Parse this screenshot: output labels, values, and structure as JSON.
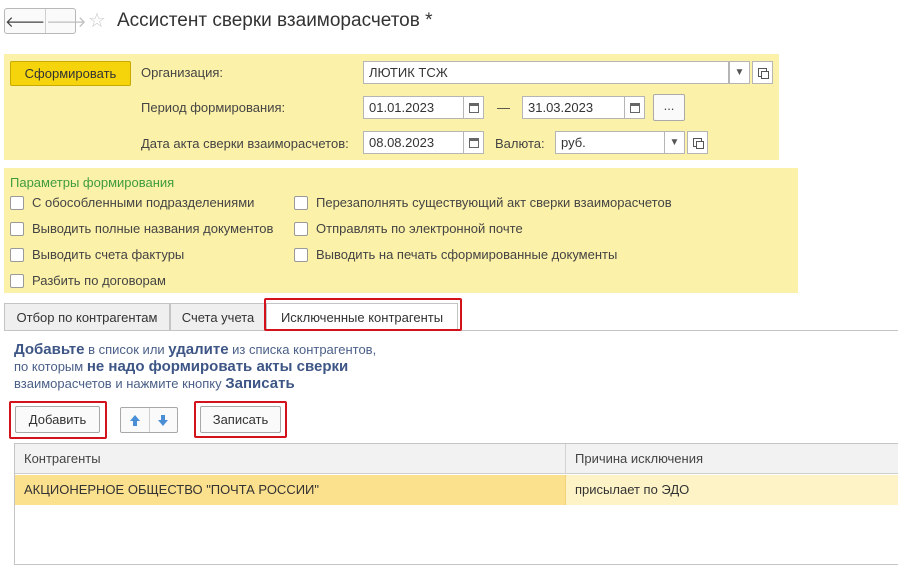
{
  "window": {
    "title": "Ассистент сверки взаиморасчетов *"
  },
  "toolbar": {
    "generate_label": "Сформировать"
  },
  "form": {
    "organization_label": "Организация:",
    "organization_value": "ЛЮТИК ТСЖ",
    "period_label": "Период формирования:",
    "period_from": "01.01.2023",
    "period_dash": "—",
    "period_to": "31.03.2023",
    "period_more": "...",
    "act_date_label": "Дата акта сверки взаиморасчетов:",
    "act_date_value": "08.08.2023",
    "currency_label": "Валюта:",
    "currency_value": "руб."
  },
  "params": {
    "title": "Параметры формирования",
    "left": [
      "С обособленными подразделениями",
      "Выводить полные названия документов",
      "Выводить счета фактуры",
      "Разбить по договорам"
    ],
    "right": [
      "Перезаполнять существующий акт сверки взаиморасчетов",
      "Отправлять по электронной почте",
      "Выводить на печать сформированные документы"
    ]
  },
  "tabs": [
    "Отбор по контрагентам",
    "Счета учета",
    "Исключенные контрагенты"
  ],
  "hint": {
    "p1": "Добавьте",
    "p2": " в список или ",
    "p3": "удалите",
    "p4": " из списка контрагентов,",
    "p5": "по которым ",
    "p6": "не надо формировать акты сверки",
    "p7": "взаиморасчетов и нажмите кнопку ",
    "p8": "Записать"
  },
  "actions": {
    "add_label": "Добавить",
    "save_label": "Записать"
  },
  "table": {
    "columns": [
      "Контрагенты",
      "Причина исключения"
    ],
    "rows": [
      {
        "counterparty": "АКЦИОНЕРНОЕ ОБЩЕСТВО \"ПОЧТА РОССИИ\"",
        "reason": "присылает по ЭДО"
      }
    ]
  },
  "colors": {
    "panel": "#fcf1a8",
    "primary_button": "#f5d40c",
    "highlight_frame": "#d4121b",
    "selected_row": "#fbe08e",
    "section_title": "#3f9c3f",
    "hint_text": "#3e5686"
  }
}
